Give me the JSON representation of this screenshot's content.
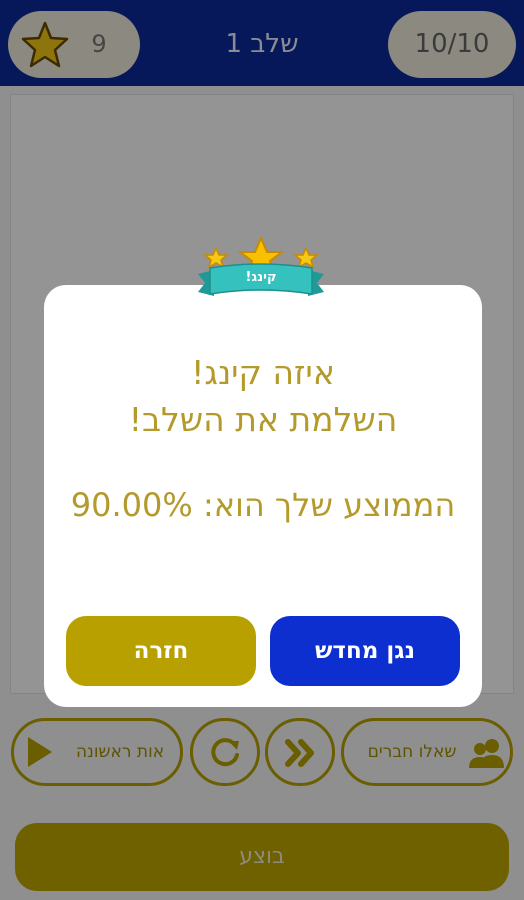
{
  "header": {
    "stars_count": "9",
    "level_title": "שלב 1",
    "progress": "10/10"
  },
  "toolbar": {
    "first_letter_label": "אות ראשונה",
    "ask_friends_label": "שאלו חברים"
  },
  "submit_label": "בוצע",
  "dialog": {
    "badge_text": "קינג!",
    "line1": "איזה קינג!",
    "line2": "השלמת את השלב!",
    "line3": "הממוצע שלך הוא: 90.00%",
    "back_label": "חזרה",
    "replay_label": "נגן מחדש"
  },
  "colors": {
    "topbar": "#0b2a9a",
    "gold": "#b8a000",
    "blue_button": "#0d2fd0",
    "dialog_text": "#b39a2a"
  },
  "icons": [
    "star-icon",
    "play-icon",
    "reset-icon",
    "skip-icon",
    "users-icon"
  ]
}
